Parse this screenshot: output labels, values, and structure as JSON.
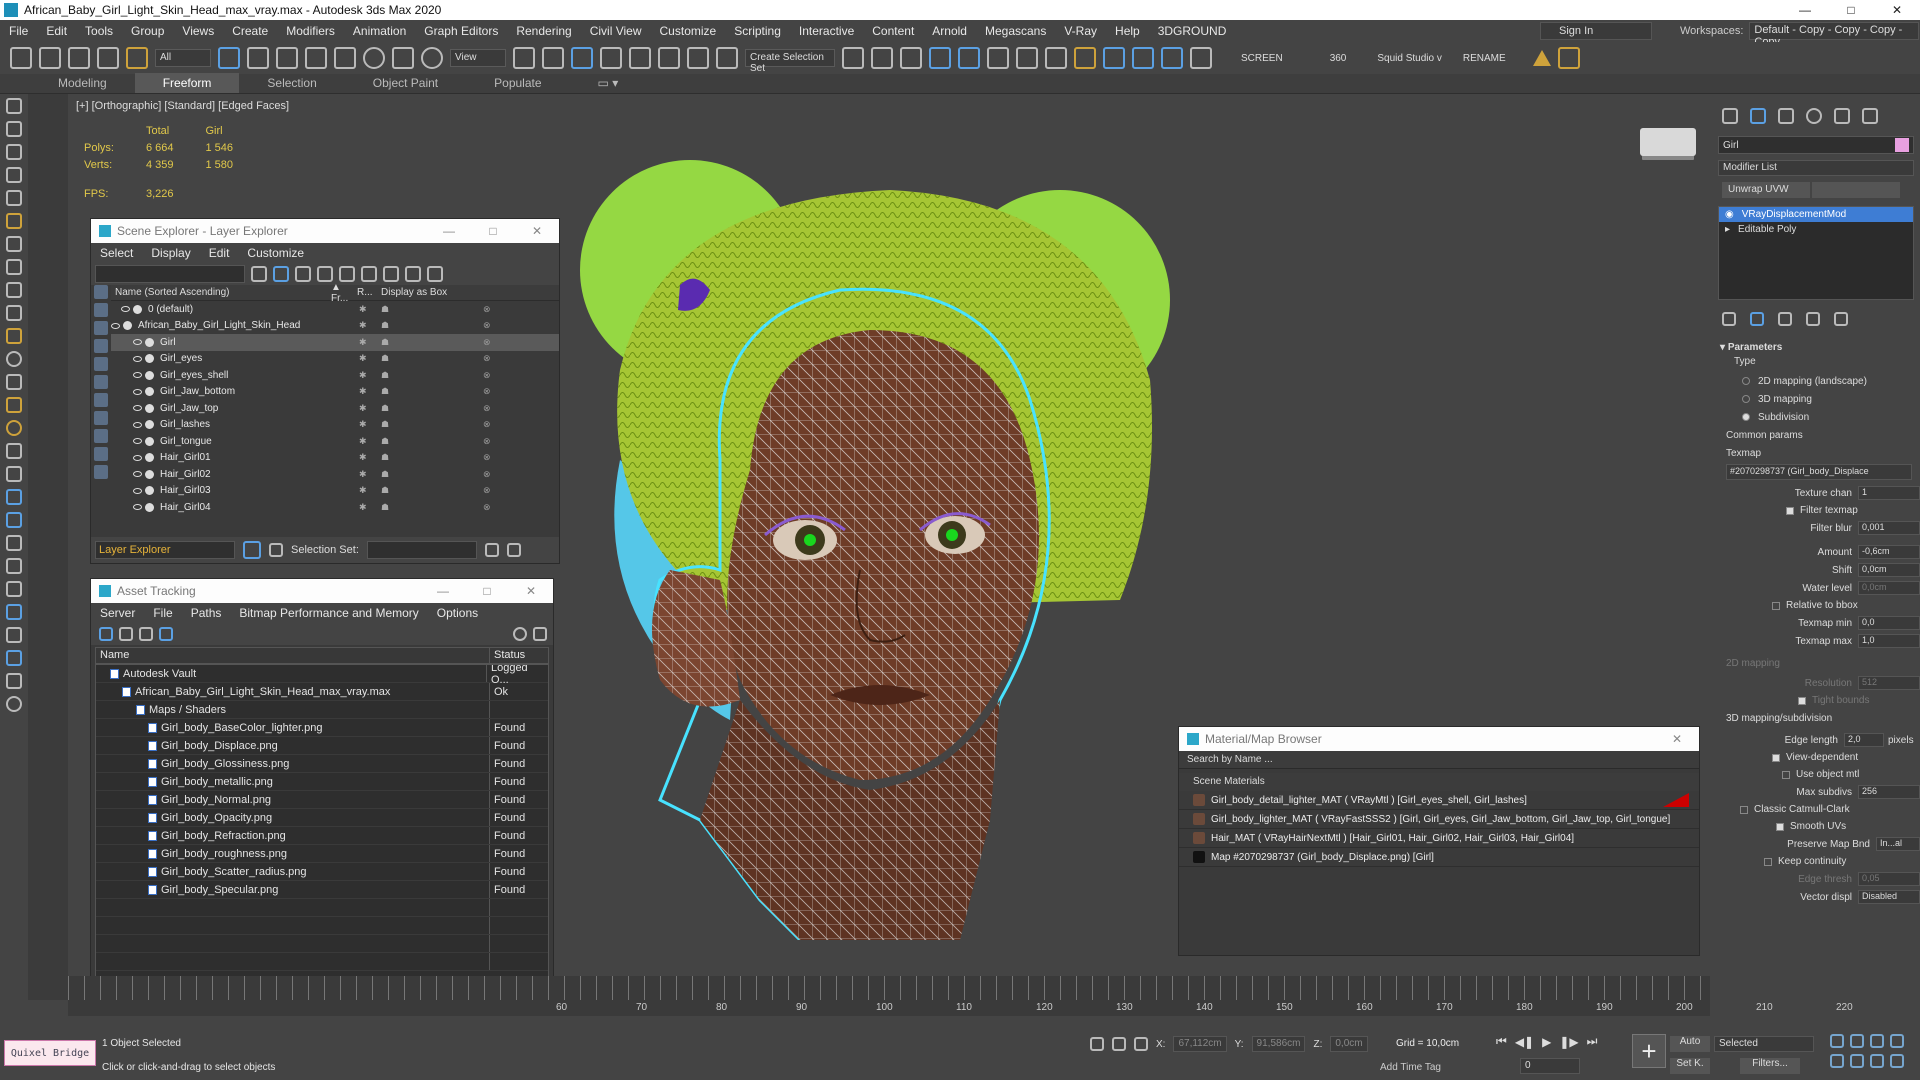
{
  "window": {
    "title": "African_Baby_Girl_Light_Skin_Head_max_vray.max - Autodesk 3ds Max 2020",
    "controls": [
      "—",
      "□",
      "✕"
    ]
  },
  "menu": [
    "File",
    "Edit",
    "Tools",
    "Group",
    "Views",
    "Create",
    "Modifiers",
    "Animation",
    "Graph Editors",
    "Rendering",
    "Civil View",
    "Customize",
    "Scripting",
    "Interactive",
    "Content",
    "Arnold",
    "Megascans",
    "V-Ray",
    "Help",
    "3DGROUND"
  ],
  "signin": "Sign In",
  "workspaces": {
    "label": "Workspaces:",
    "value": "Default - Copy - Copy - Copy - Copy"
  },
  "toolbar": {
    "filter": "All",
    "refcoord": "View",
    "selset": "Create Selection Set",
    "screen": "SCREEN",
    "n360": "360",
    "squid": "Squid Studio v",
    "rename": "RENAME"
  },
  "ribbon": [
    "Modeling",
    "Freeform",
    "Selection",
    "Object Paint",
    "Populate"
  ],
  "viewport": {
    "label": "[+] [Orthographic] [Standard] [Edged Faces]",
    "stats": {
      "h_total": "Total",
      "h_girl": "Girl",
      "polys_label": "Polys:",
      "polys_total": "6 664",
      "polys_girl": "1 546",
      "verts_label": "Verts:",
      "verts_total": "4 359",
      "verts_girl": "1 580",
      "fps_label": "FPS:",
      "fps": "3,226"
    }
  },
  "scene_explorer": {
    "title": "Scene Explorer - Layer Explorer",
    "menu": [
      "Select",
      "Display",
      "Edit",
      "Customize"
    ],
    "col_name": "Name (Sorted Ascending)",
    "col_fr": "▲ Fr...",
    "col_r": "R...",
    "col_box": "Display as Box",
    "rows": [
      {
        "name": "0 (default)",
        "indent": 1
      },
      {
        "name": "African_Baby_Girl_Light_Skin_Head",
        "indent": 0
      },
      {
        "name": "Girl",
        "indent": 2,
        "selected": true
      },
      {
        "name": "Girl_eyes",
        "indent": 2
      },
      {
        "name": "Girl_eyes_shell",
        "indent": 2
      },
      {
        "name": "Girl_Jaw_bottom",
        "indent": 2
      },
      {
        "name": "Girl_Jaw_top",
        "indent": 2
      },
      {
        "name": "Girl_lashes",
        "indent": 2
      },
      {
        "name": "Girl_tongue",
        "indent": 2
      },
      {
        "name": "Hair_Girl01",
        "indent": 2
      },
      {
        "name": "Hair_Girl02",
        "indent": 2
      },
      {
        "name": "Hair_Girl03",
        "indent": 2
      },
      {
        "name": "Hair_Girl04",
        "indent": 2
      }
    ],
    "footer_dd": "Layer Explorer",
    "selset_label": "Selection Set:"
  },
  "asset": {
    "title": "Asset Tracking",
    "menu": [
      "Server",
      "File",
      "Paths",
      "Bitmap Performance and Memory",
      "Options"
    ],
    "col_name": "Name",
    "col_status": "Status",
    "rows": [
      {
        "name": "Autodesk Vault",
        "status": "Logged O...",
        "indent": 1
      },
      {
        "name": "African_Baby_Girl_Light_Skin_Head_max_vray.max",
        "status": "Ok",
        "indent": 2
      },
      {
        "name": "Maps / Shaders",
        "status": "",
        "indent": 3
      },
      {
        "name": "Girl_body_BaseColor_lighter.png",
        "status": "Found",
        "indent": 4
      },
      {
        "name": "Girl_body_Displace.png",
        "status": "Found",
        "indent": 4
      },
      {
        "name": "Girl_body_Glossiness.png",
        "status": "Found",
        "indent": 4
      },
      {
        "name": "Girl_body_metallic.png",
        "status": "Found",
        "indent": 4
      },
      {
        "name": "Girl_body_Normal.png",
        "status": "Found",
        "indent": 4
      },
      {
        "name": "Girl_body_Opacity.png",
        "status": "Found",
        "indent": 4
      },
      {
        "name": "Girl_body_Refraction.png",
        "status": "Found",
        "indent": 4
      },
      {
        "name": "Girl_body_roughness.png",
        "status": "Found",
        "indent": 4
      },
      {
        "name": "Girl_body_Scatter_radius.png",
        "status": "Found",
        "indent": 4
      },
      {
        "name": "Girl_body_Specular.png",
        "status": "Found",
        "indent": 4
      }
    ]
  },
  "matbrowser": {
    "title": "Material/Map Browser",
    "search": "Search by Name ...",
    "section": "Scene Materials",
    "rows": [
      "Girl_body_detail_lighter_MAT  ( VRayMtl )  [Girl_eyes_shell, Girl_lashes]",
      "Girl_body_lighter_MAT  ( VRayFastSSS2 )  [Girl, Girl_eyes, Girl_Jaw_bottom, Girl_Jaw_top, Girl_tongue]",
      "Hair_MAT  ( VRayHairNextMtl )  [Hair_Girl01, Hair_Girl02, Hair_Girl03, Hair_Girl04]",
      "Map #2070298737 (Girl_body_Displace.png)  [Girl]"
    ]
  },
  "cmd": {
    "name": "Girl",
    "modlist": "Modifier List",
    "unwrap": "Unwrap UVW",
    "stack": [
      "VRayDisplacementMod",
      "Editable Poly"
    ],
    "params_title": "Parameters",
    "type_label": "Type",
    "types": [
      "2D mapping (landscape)",
      "3D mapping",
      "Subdivision"
    ],
    "common": "Common params",
    "texmap_label": "Texmap",
    "texmap": "#2070298737 (Girl_body_Displace",
    "texchan_label": "Texture chan",
    "texchan": "1",
    "filter_texmap": "Filter texmap",
    "filter_blur_label": "Filter blur",
    "filter_blur": "0,001",
    "amount_label": "Amount",
    "amount": "-0,6cm",
    "shift_label": "Shift",
    "shift": "0,0cm",
    "water_label": "Water level",
    "water": "0,0cm",
    "relative": "Relative to bbox",
    "tmin_label": "Texmap min",
    "tmin": "0,0",
    "tmax_label": "Texmap max",
    "tmax": "1,0",
    "map2d": "2D mapping",
    "res_label": "Resolution",
    "res": "512",
    "tight": "Tight bounds",
    "map3d": "3D mapping/subdivision",
    "edge_label": "Edge length",
    "edge": "2,0",
    "pixels": "pixels",
    "viewdep": "View-dependent",
    "useobj": "Use object mtl",
    "maxsub_label": "Max subdivs",
    "maxsub": "256",
    "catmull": "Classic Catmull-Clark",
    "smooth": "Smooth UVs",
    "preserve_label": "Preserve Map Bnd",
    "preserve": "In...al",
    "keep": "Keep continuity",
    "edgethr_label": "Edge thresh",
    "edgethr": "0,05",
    "vector_label": "Vector displ",
    "vector": "Disabled"
  },
  "timeline": [
    "60",
    "70",
    "80",
    "90",
    "100",
    "110",
    "120",
    "130",
    "140",
    "150",
    "160",
    "170",
    "180",
    "190",
    "200",
    "210",
    "220"
  ],
  "status": {
    "quixel": "Quixel Bridge",
    "selected": "1 Object Selected",
    "hint": "Click or click-and-drag to select objects",
    "x_label": "X:",
    "x": "67,112cm",
    "y_label": "Y:",
    "y": "91,586cm",
    "z_label": "Z:",
    "z": "0,0cm",
    "grid": "Grid = 10,0cm",
    "addtag": "Add Time Tag",
    "auto": "Auto",
    "setk": "Set K.",
    "sel": "Selected",
    "filters": "Filters...",
    "frame": "0"
  }
}
